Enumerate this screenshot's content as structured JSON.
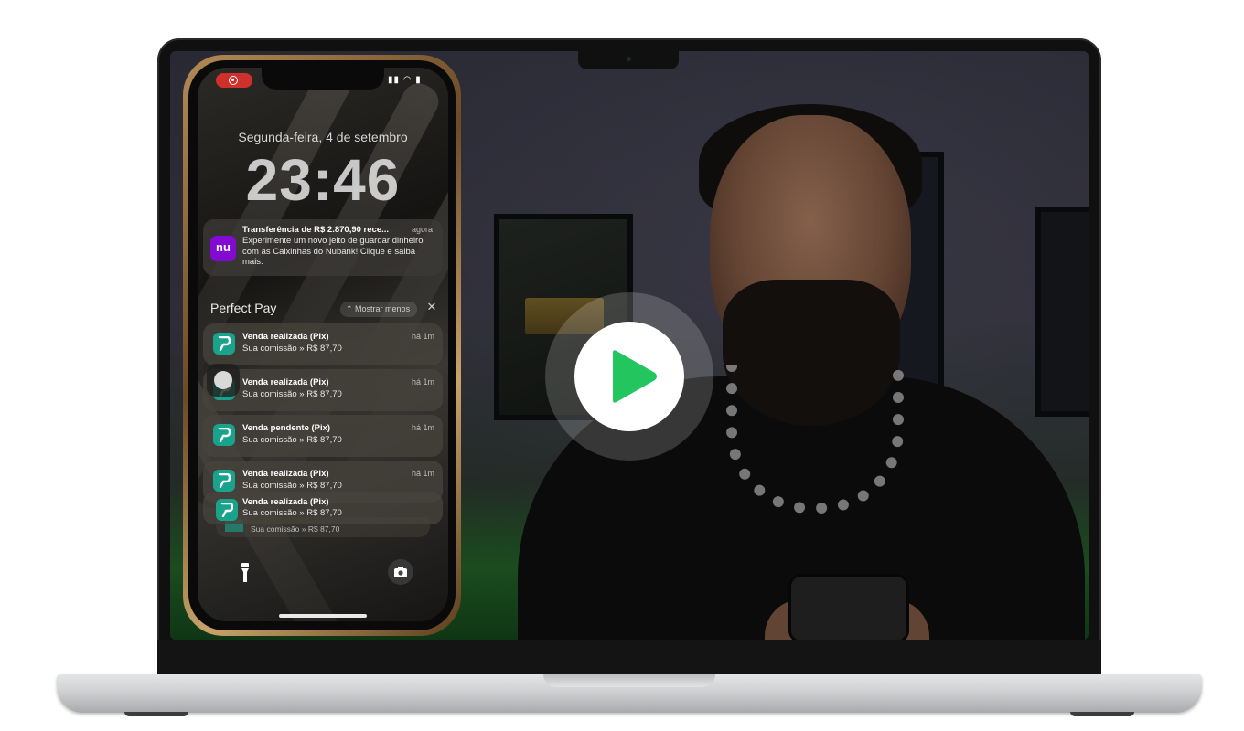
{
  "lock_screen": {
    "date": "Segunda-feira, 4 de setembro",
    "time": "23:46"
  },
  "nubank_notification": {
    "logo_text": "nu",
    "title": "Transferência de R$ 2.870,90 rece...",
    "time": "agora",
    "body": "Experimente um novo jeito de guardar dinheiro com as Caixinhas do Nubank! Clique e saiba mais."
  },
  "group": {
    "title": "Perfect Pay",
    "show_less": "Mostrar menos",
    "close": "✕"
  },
  "notifications": [
    {
      "title": "Venda realizada (Pix)",
      "body": "Sua comissão » R$ 87,70",
      "time": "há 1m"
    },
    {
      "title": "Venda realizada (Pix)",
      "body": "Sua comissão » R$ 87,70",
      "time": "há 1m"
    },
    {
      "title": "Venda pendente (Pix)",
      "body": "Sua comissão » R$ 87,70",
      "time": "há 1m"
    },
    {
      "title": "Venda realizada (Pix)",
      "body": "Sua comissão » R$ 87,70",
      "time": "há 1m"
    },
    {
      "title": "Venda realizada (Pix)",
      "body": "Sua comissão » R$ 87,70",
      "time": ""
    }
  ],
  "stack_ghost_text": "Sua comissão » R$ 87,70",
  "colors": {
    "play_icon": "#22c55e",
    "nubank_purple": "#820ad1",
    "perfectpay_teal": "#1aa38c"
  },
  "icons": {
    "play": "play-triangle-icon",
    "camera": "camera-icon",
    "flashlight": "flashlight-icon"
  }
}
